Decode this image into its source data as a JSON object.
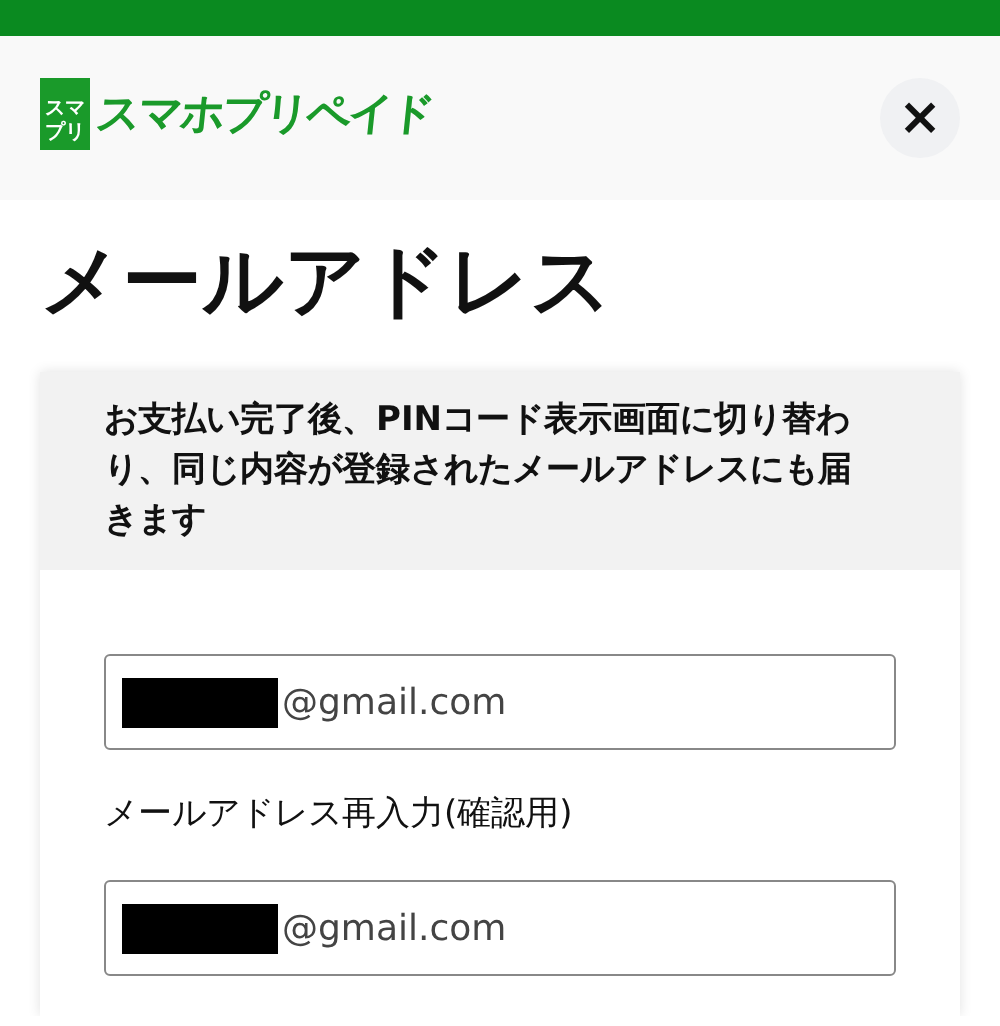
{
  "header": {
    "logo": {
      "badge_lines": [
        "スマ",
        "プリ"
      ],
      "text": "スマホプリペイド"
    },
    "close_label": "×"
  },
  "title": "メールアドレス",
  "card": {
    "notice": "お支払い完了後、PINコード表示画面に切り替わり、同じ内容が登録されたメールアドレスにも届きます",
    "fields": [
      {
        "value": "@gmail.com",
        "redacted": true
      },
      {
        "label": "メールアドレス再入力(確認用)",
        "value": "@gmail.com",
        "redacted": true
      }
    ]
  }
}
